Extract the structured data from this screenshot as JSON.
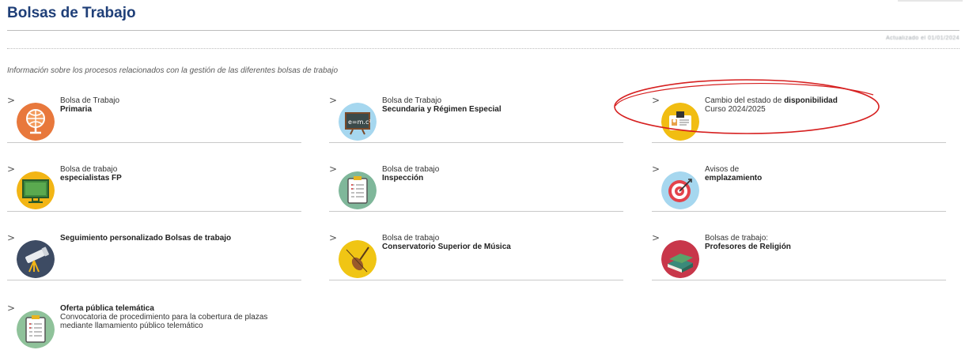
{
  "header": {
    "title": "Bolsas de Trabajo",
    "updated": "Actualizado el 01/01/2024"
  },
  "intro": "Información sobre los procesos relacionados con la gestión de las diferentes bolsas de trabajo",
  "cards": [
    {
      "line1": "Bolsa de Trabajo",
      "line2": "Primaria",
      "icon": "globe-icon",
      "bg": "#e8783c"
    },
    {
      "line1": "Bolsa de Trabajo",
      "line2": "Secundaria y Régimen Especial",
      "icon": "blackboard-icon",
      "bg": "#a6d7ef"
    },
    {
      "line1a": "Cambio del estado de ",
      "line1b": "disponibilidad",
      "line2": "Curso 2024/2025",
      "icon": "id-card-icon",
      "bg": "#f1bd12"
    },
    {
      "line1": "Bolsa de trabajo",
      "line2": "especialistas FP",
      "icon": "monitor-icon",
      "bg": "#f2b515"
    },
    {
      "line1": "Bolsa de trabajo",
      "line2": "Inspección",
      "icon": "clipboard-icon",
      "bg": "#7fb79a"
    },
    {
      "line1": "Avisos de",
      "line2": "emplazamiento",
      "icon": "target-icon",
      "bg": "#a6d7ef"
    },
    {
      "line1": "Seguimiento personalizado Bolsas de trabajo",
      "icon": "telescope-icon",
      "bg": "#3d4b63"
    },
    {
      "line1": "Bolsa de trabajo",
      "line2": "Conservatorio Superior de Música",
      "icon": "violin-icon",
      "bg": "#f0c514"
    },
    {
      "line1": "Bolsas de trabajo:",
      "line2": "Profesores de Religión",
      "icon": "books-icon",
      "bg": "#c8374a"
    },
    {
      "line1": "Oferta pública telemática",
      "line2": "Convocatoria de procedimiento para la cobertura de plazas",
      "line3": "mediante llamamiento público telemático",
      "icon": "clipboard-icon",
      "bg": "#8fc29a"
    }
  ],
  "chevron": ">",
  "highlight_color": "#d62020"
}
